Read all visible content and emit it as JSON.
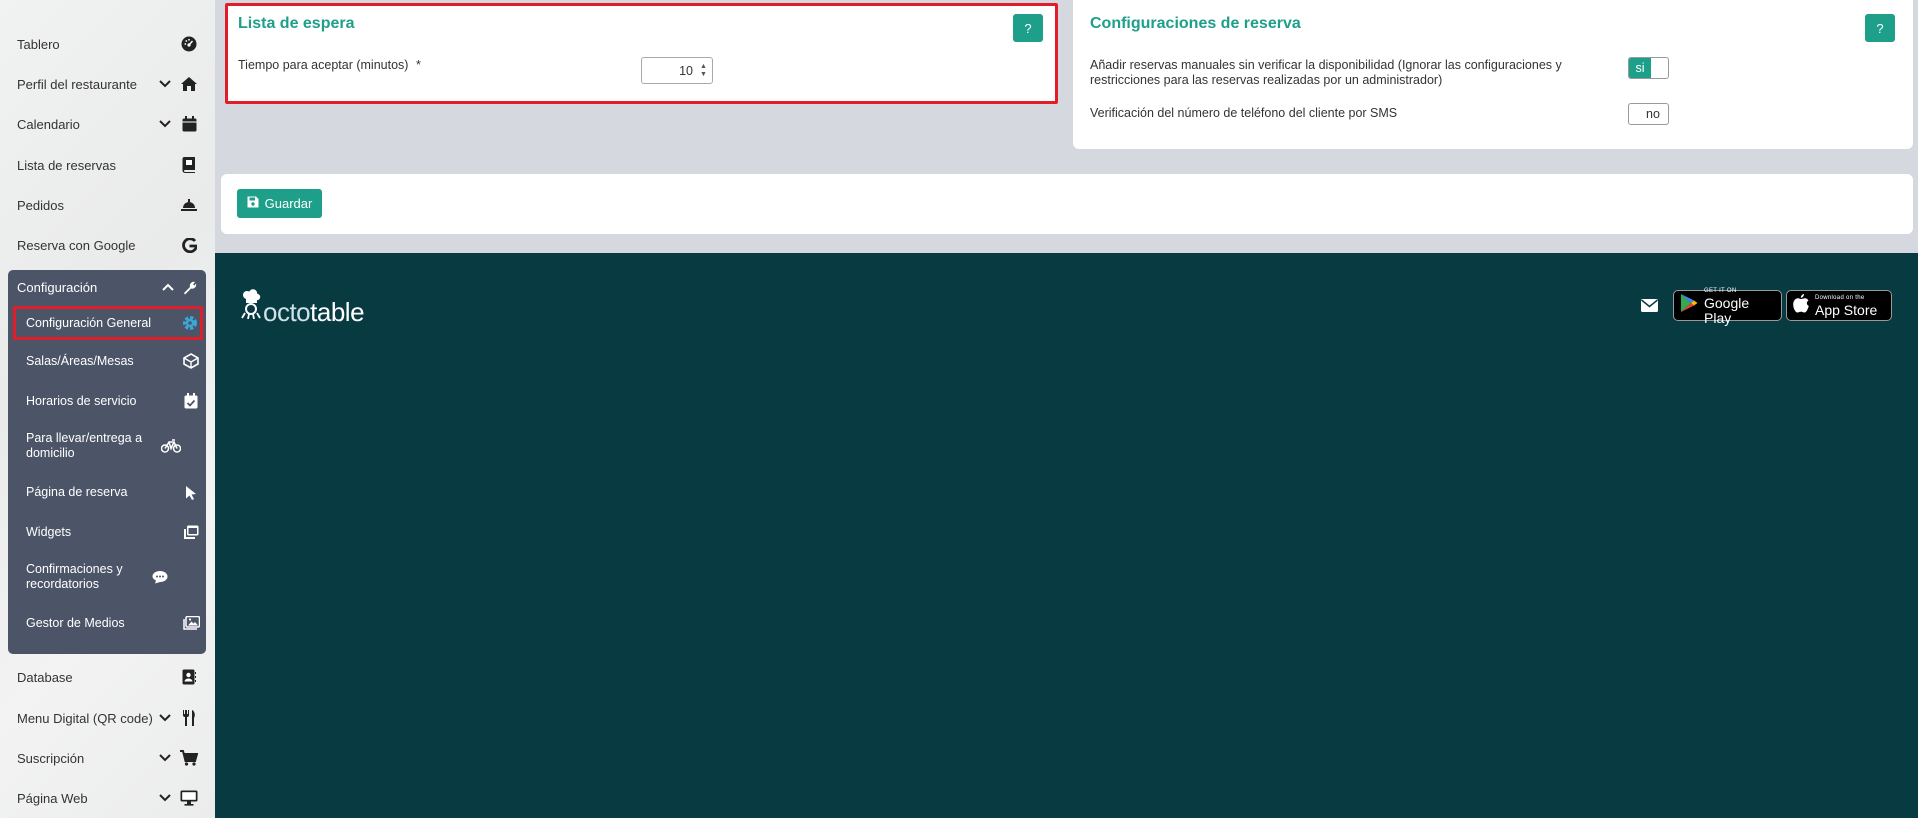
{
  "sidebar": {
    "items": [
      {
        "label": "Tablero",
        "icon": "dashboard-icon"
      },
      {
        "label": "Perfil del restaurante",
        "icon": "home-icon"
      },
      {
        "label": "Calendario",
        "icon": "calendar-icon"
      },
      {
        "label": "Lista de reservas",
        "icon": "book-icon"
      },
      {
        "label": "Pedidos",
        "icon": "bell-icon"
      },
      {
        "label": "Reserva con Google",
        "icon": "google-icon"
      }
    ],
    "config": {
      "label": "Configuración",
      "sub_items": [
        {
          "label": "Configuración General",
          "icon": "gear-icon"
        },
        {
          "label": "Salas/Áreas/Mesas",
          "icon": "cube-icon"
        },
        {
          "label": "Horarios de servicio",
          "icon": "calendar-check-icon"
        },
        {
          "label": "Para llevar/entrega a domicilio",
          "icon": "bicycle-icon"
        },
        {
          "label": "Página de reserva",
          "icon": "cursor-icon"
        },
        {
          "label": "Widgets",
          "icon": "window-icon"
        },
        {
          "label": "Confirmaciones y recordatorios",
          "icon": "chat-icon"
        },
        {
          "label": "Gestor de Medios",
          "icon": "image-icon"
        }
      ]
    },
    "bottom_items": [
      {
        "label": "Database",
        "icon": "contact-card-icon"
      },
      {
        "label": "Menu Digital (QR code)",
        "icon": "utensils-icon"
      },
      {
        "label": "Suscripción",
        "icon": "cart-icon"
      },
      {
        "label": "Página Web",
        "icon": "monitor-icon"
      }
    ]
  },
  "waitlist": {
    "title": "Lista de espera",
    "help": "?",
    "accept_time_label": "Tiempo para aceptar (minutos)",
    "required_mark": "*",
    "accept_time_value": "10"
  },
  "reservation_settings": {
    "title": "Configuraciones de reserva",
    "help": "?",
    "manual_label": "Añadir reservas manuales sin verificar la disponibilidad (Ignorar las configuraciones y restricciones para las reservas realizadas por un administrador)",
    "manual_toggle": "si",
    "sms_label": "Verificación del número de teléfono del cliente por SMS",
    "sms_toggle": "no"
  },
  "save_label": "Guardar",
  "footer": {
    "logo_octo": "octo",
    "logo_table": "table",
    "google_play_small": "GET IT ON",
    "google_play_big": "Google Play",
    "app_store_small": "Download on the",
    "app_store_big": "App Store"
  },
  "colors": {
    "accent": "#1d9f8a",
    "footer_bg": "#083a42",
    "sidebar_config_bg": "#4c5568",
    "highlight": "#e11d2a"
  }
}
